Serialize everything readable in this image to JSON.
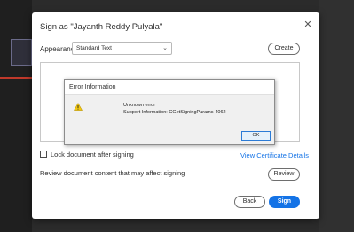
{
  "dialog": {
    "title": "Sign as \"Jayanth Reddy Pulyala\"",
    "close_glyph": "✕",
    "appearance_label": "Appearance",
    "appearance_value": "Standard Text",
    "create_label": "Create",
    "lock_label": "Lock document after signing",
    "lock_checked": false,
    "view_certificate_label": "View Certificate Details",
    "review_text": "Review document content that may affect signing",
    "review_label": "Review",
    "back_label": "Back",
    "sign_label": "Sign"
  },
  "error": {
    "title": "Error Information",
    "line1": "Unknown error",
    "line2": "Support Information: CGetSigningParams-4062",
    "ok_label": "OK"
  },
  "colors": {
    "accent": "#1473e6",
    "warning": "#f2c811"
  },
  "icons": {
    "close": "close-icon",
    "chevron": "chevron-down-icon",
    "warning": "warning-icon"
  }
}
